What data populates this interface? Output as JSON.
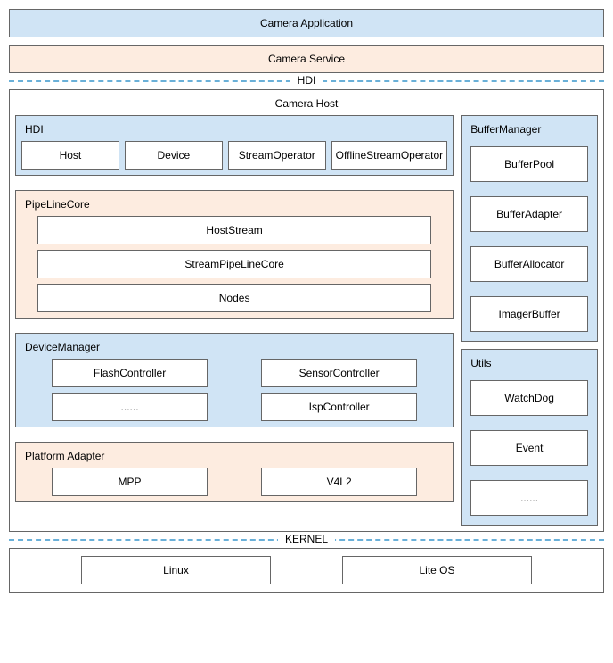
{
  "top": {
    "app": "Camera Application",
    "service": "Camera Service"
  },
  "separators": {
    "hdi": "HDI",
    "kernel": "KERNEL"
  },
  "cameraHost": {
    "title": "Camera Host",
    "hdi": {
      "title": "HDI",
      "items": [
        "Host",
        "Device",
        "StreamOperator",
        "OfflineStreamOperator"
      ]
    },
    "pipeline": {
      "title": "PipeLineCore",
      "items": [
        "HostStream",
        "StreamPipeLineCore",
        "Nodes"
      ]
    },
    "deviceManager": {
      "title": "DeviceManager",
      "items": [
        "FlashController",
        "SensorController",
        "......",
        "IspController"
      ]
    },
    "platformAdapter": {
      "title": "Platform Adapter",
      "items": [
        "MPP",
        "V4L2"
      ]
    },
    "bufferManager": {
      "title": "BufferManager",
      "items": [
        "BufferPool",
        "BufferAdapter",
        "BufferAllocator",
        "ImagerBuffer"
      ]
    },
    "utils": {
      "title": "Utils",
      "items": [
        "WatchDog",
        "Event",
        "......"
      ]
    }
  },
  "kernel": {
    "items": [
      "Linux",
      "Lite OS"
    ]
  }
}
